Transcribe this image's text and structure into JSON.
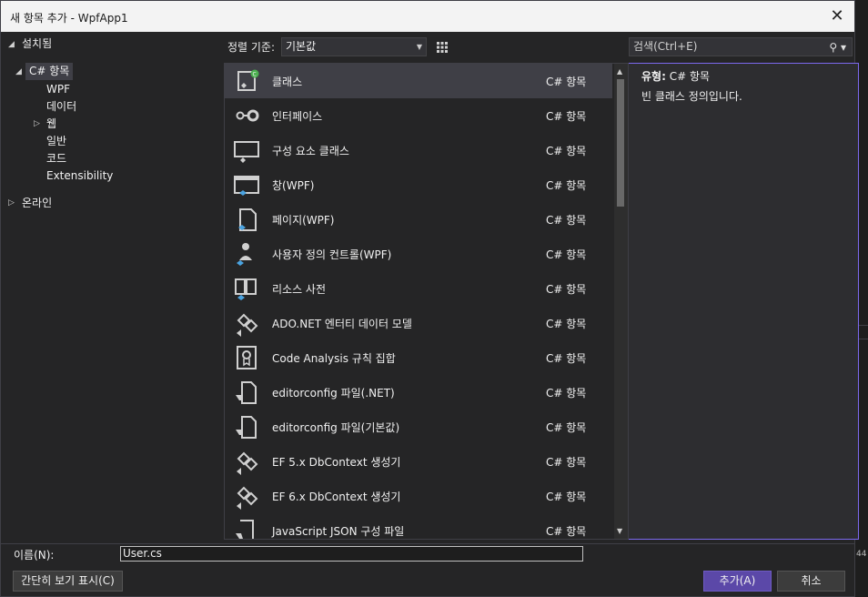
{
  "window": {
    "title": "새 항목 추가 - WpfApp1",
    "close_glyph": "✕"
  },
  "tree": {
    "installed": "설치됨",
    "csharp": "C# 항목",
    "children": [
      "WPF",
      "데이터",
      "웹",
      "일반",
      "코드",
      "Extensibility"
    ],
    "online": "온라인"
  },
  "sort": {
    "label": "정렬 기준:",
    "value": "기본값"
  },
  "search": {
    "placeholder": "검색(Ctrl+E)"
  },
  "items": [
    {
      "name": "클래스",
      "category": "C# 항목",
      "icon": "class-icon"
    },
    {
      "name": "인터페이스",
      "category": "C# 항목",
      "icon": "interface-icon"
    },
    {
      "name": "구성 요소 클래스",
      "category": "C# 항목",
      "icon": "component-class-icon"
    },
    {
      "name": "창(WPF)",
      "category": "C# 항목",
      "icon": "window-icon"
    },
    {
      "name": "페이지(WPF)",
      "category": "C# 항목",
      "icon": "page-icon"
    },
    {
      "name": "사용자 정의 컨트롤(WPF)",
      "category": "C# 항목",
      "icon": "user-control-icon"
    },
    {
      "name": "리소스 사전",
      "category": "C# 항목",
      "icon": "resource-dictionary-icon"
    },
    {
      "name": "ADO.NET 엔터티 데이터 모델",
      "category": "C# 항목",
      "icon": "entity-model-icon"
    },
    {
      "name": "Code Analysis 규칙 집합",
      "category": "C# 항목",
      "icon": "ruleset-icon"
    },
    {
      "name": "editorconfig 파일(.NET)",
      "category": "C# 항목",
      "icon": "editorconfig-icon"
    },
    {
      "name": "editorconfig 파일(기본값)",
      "category": "C# 항목",
      "icon": "editorconfig-icon"
    },
    {
      "name": "EF 5.x DbContext 생성기",
      "category": "C# 항목",
      "icon": "dbcontext-icon"
    },
    {
      "name": "EF 6.x DbContext 생성기",
      "category": "C# 항목",
      "icon": "dbcontext-icon"
    },
    {
      "name": "JavaScript JSON 구성 파일",
      "category": "C# 항목",
      "icon": "json-config-icon"
    }
  ],
  "details": {
    "type_label": "유형:",
    "type_value": "C# 항목",
    "description": "빈 클래스 정의입니다."
  },
  "bottom": {
    "name_label": "이름(N):",
    "name_value": "User.cs",
    "compact_label": "간단히 보기 표시(C)",
    "add_label": "추가(A)",
    "cancel_label": "취소"
  },
  "background": {
    "number": "44"
  },
  "colors": {
    "accent": "#5b48a8",
    "panel": "#252526",
    "selection": "#3f3f46"
  }
}
